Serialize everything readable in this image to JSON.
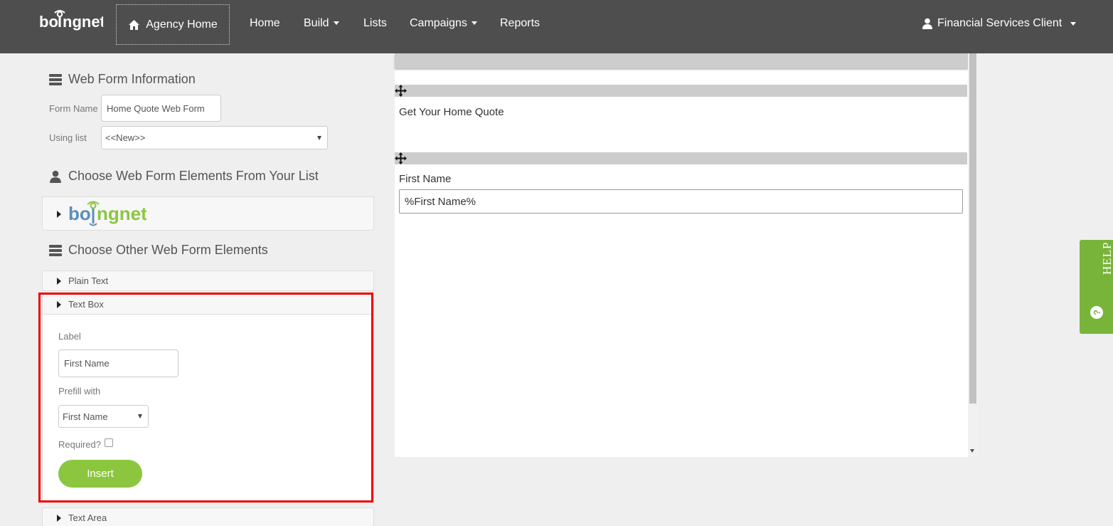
{
  "header": {
    "logo_icon": "boingnet-logo",
    "agency_home_label": "Agency Home",
    "nav": {
      "home": "Home",
      "build": "Build",
      "lists": "Lists",
      "campaigns": "Campaigns",
      "reports": "Reports"
    },
    "user_label": "Financial Services Client"
  },
  "web_form_info": {
    "title": "Web Form Information",
    "form_name_label": "Form Name",
    "form_name_value": "Home Quote Web Form",
    "using_list_label": "Using list",
    "using_list_value": "<<New>>"
  },
  "list_elements": {
    "title": "Choose Web Form Elements From Your List"
  },
  "other_elements": {
    "title": "Choose Other Web Form Elements",
    "plain_text": "Plain Text",
    "text_box": "Text Box",
    "text_area": "Text Area"
  },
  "textbox_form": {
    "label_caption": "Label",
    "label_value": "First Name",
    "prefill_caption": "Prefill with",
    "prefill_value": "First Name",
    "required_caption": "Required?",
    "insert_label": "Insert"
  },
  "preview": {
    "heading": "Get Your Home Quote",
    "field_label": "First Name",
    "field_value": "%First Name%"
  },
  "help": {
    "label": "HELP",
    "icon_glyph": "?"
  },
  "colors": {
    "nav_bg": "#4e4e4e",
    "accent_green": "#8cc63f",
    "help_green": "#79b43a",
    "highlight_red": "#e00000"
  }
}
